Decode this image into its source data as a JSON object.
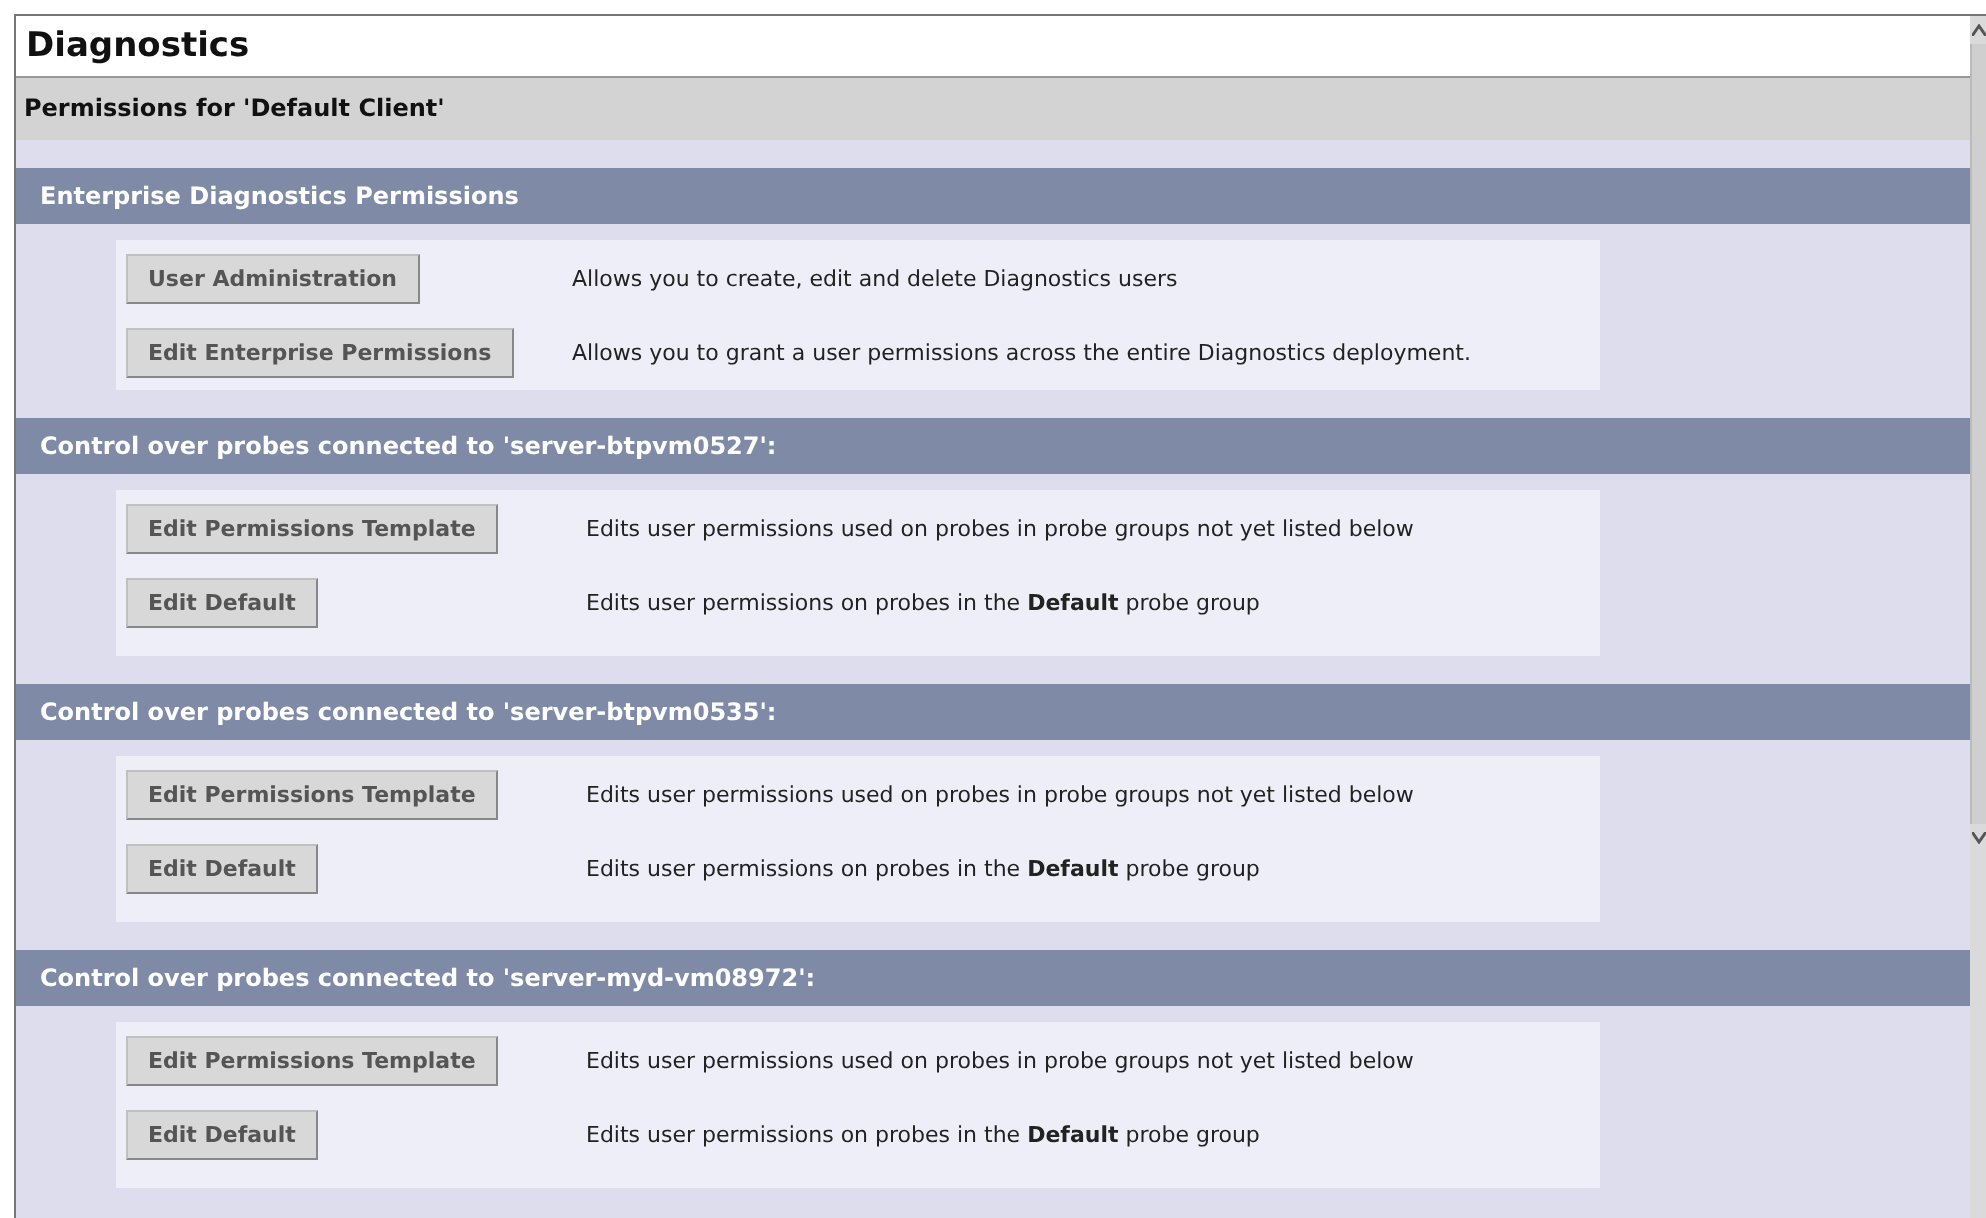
{
  "title": "Diagnostics",
  "subtitle": "Permissions for 'Default Client'",
  "sections": [
    {
      "title": "Enterprise Diagnostics Permissions",
      "actions": [
        {
          "button": "User Administration",
          "description": "Allows you to create, edit and delete Diagnostics users"
        },
        {
          "button": "Edit Enterprise Permissions",
          "description": "Allows you to grant a user permissions across the entire Diagnostics deployment."
        }
      ]
    },
    {
      "title": "Control over probes connected to 'server-btpvm0527':",
      "actions": [
        {
          "button": "Edit Permissions Template",
          "description": "Edits user permissions used on probes in probe groups not yet listed below"
        },
        {
          "button": "Edit Default",
          "description": "Edits user permissions on probes in the **Default** probe group"
        }
      ]
    },
    {
      "title": "Control over probes connected to 'server-btpvm0535':",
      "actions": [
        {
          "button": "Edit Permissions Template",
          "description": "Edits user permissions used on probes in probe groups not yet listed below"
        },
        {
          "button": "Edit Default",
          "description": "Edits user permissions on probes in the **Default** probe group"
        }
      ]
    },
    {
      "title": "Control over probes connected to 'server-myd-vm08972':",
      "actions": [
        {
          "button": "Edit Permissions Template",
          "description": "Edits user permissions used on probes in probe groups not yet listed below"
        },
        {
          "button": "Edit Default",
          "description": "Edits user permissions on probes in the **Default** probe group"
        }
      ]
    }
  ]
}
